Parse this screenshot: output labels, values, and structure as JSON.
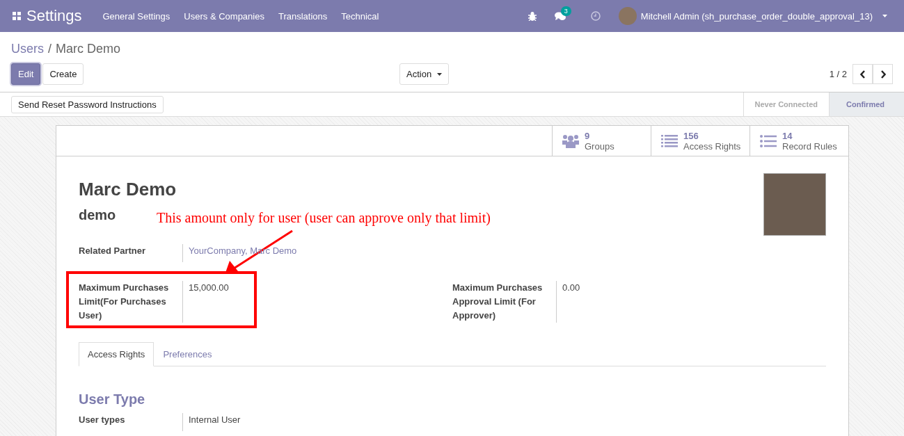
{
  "navbar": {
    "app_title": "Settings",
    "menu": [
      "General Settings",
      "Users & Companies",
      "Translations",
      "Technical"
    ],
    "message_count": "3",
    "user": "Mitchell Admin (sh_purchase_order_double_approval_13)"
  },
  "breadcrumb": {
    "separator": "/",
    "items": [
      {
        "label": "Users",
        "link": true
      },
      {
        "label": "Marc Demo",
        "link": false
      }
    ]
  },
  "buttons": [
    {
      "label": "Edit",
      "primary": true
    },
    {
      "label": "Create",
      "primary": false
    }
  ],
  "action": "Action",
  "pager": "1 / 2",
  "status_bar": {
    "button": "Send Reset Password Instructions",
    "stages": [
      {
        "label": "Never Connected",
        "selected": false
      },
      {
        "label": "Confirmed",
        "selected": true
      }
    ]
  },
  "smart_buttons": [
    {
      "kind": "groups",
      "count": "9",
      "label": "Groups"
    },
    {
      "kind": "list",
      "count": "156",
      "label": "Access Rights"
    },
    {
      "kind": "bullets",
      "count": "14",
      "label": "Record Rules"
    }
  ],
  "name": "Marc Demo",
  "login": "demo",
  "related_partner": {
    "label": "Related Partner",
    "value": "YourCompany, Marc Demo"
  },
  "limits": [
    {
      "label": "Maximum Purchases Limit(For Purchases User)",
      "value": "15,000.00",
      "highlighted": true
    },
    {
      "label": "Maximum Purchases Approval Limit (For Approver)",
      "value": "0.00",
      "highlighted": false
    }
  ],
  "tabs": [
    {
      "label": "Access Rights",
      "selected": true
    },
    {
      "label": "Preferences",
      "selected": false
    }
  ],
  "section": {
    "title": "User Type",
    "field": {
      "label": "User types",
      "value": "Internal User"
    }
  },
  "annotation": "This amount only for user (user can approve only that limit)"
}
